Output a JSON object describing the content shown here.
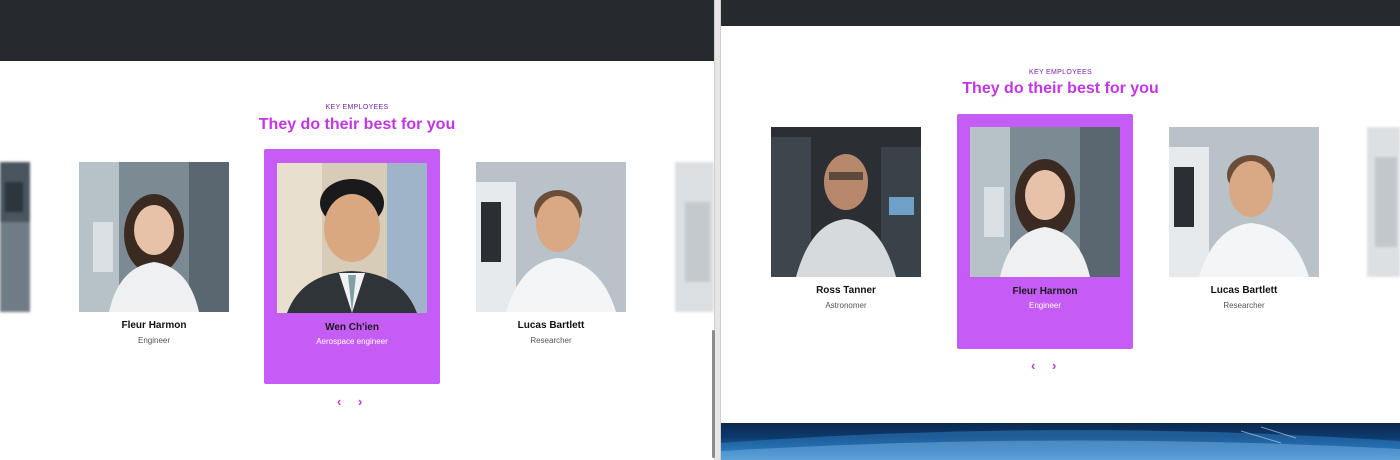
{
  "left_pane": {
    "eyebrow": "KEY EMPLOYEES",
    "heading": "They do their best for you",
    "cards": [
      {
        "name": "Fleur Harmon",
        "role": "Engineer"
      },
      {
        "name": "Wen Ch'ien",
        "role": "Aerospace engineer"
      },
      {
        "name": "Lucas Bartlett",
        "role": "Researcher"
      }
    ]
  },
  "right_pane": {
    "eyebrow": "KEY EMPLOYEES",
    "heading": "They do their best for you",
    "cards": [
      {
        "name": "Ross Tanner",
        "role": "Astronomer"
      },
      {
        "name": "Fleur Harmon",
        "role": "Engineer"
      },
      {
        "name": "Lucas Bartlett",
        "role": "Researcher"
      }
    ]
  },
  "controls": {
    "prev_icon": "chevron-left-icon",
    "next_icon": "chevron-right-icon",
    "prev_glyph": "‹",
    "next_glyph": "›"
  },
  "colors": {
    "accent": "#c236e3",
    "active_card": "#c45cf5",
    "topbar": "#262a2f"
  }
}
